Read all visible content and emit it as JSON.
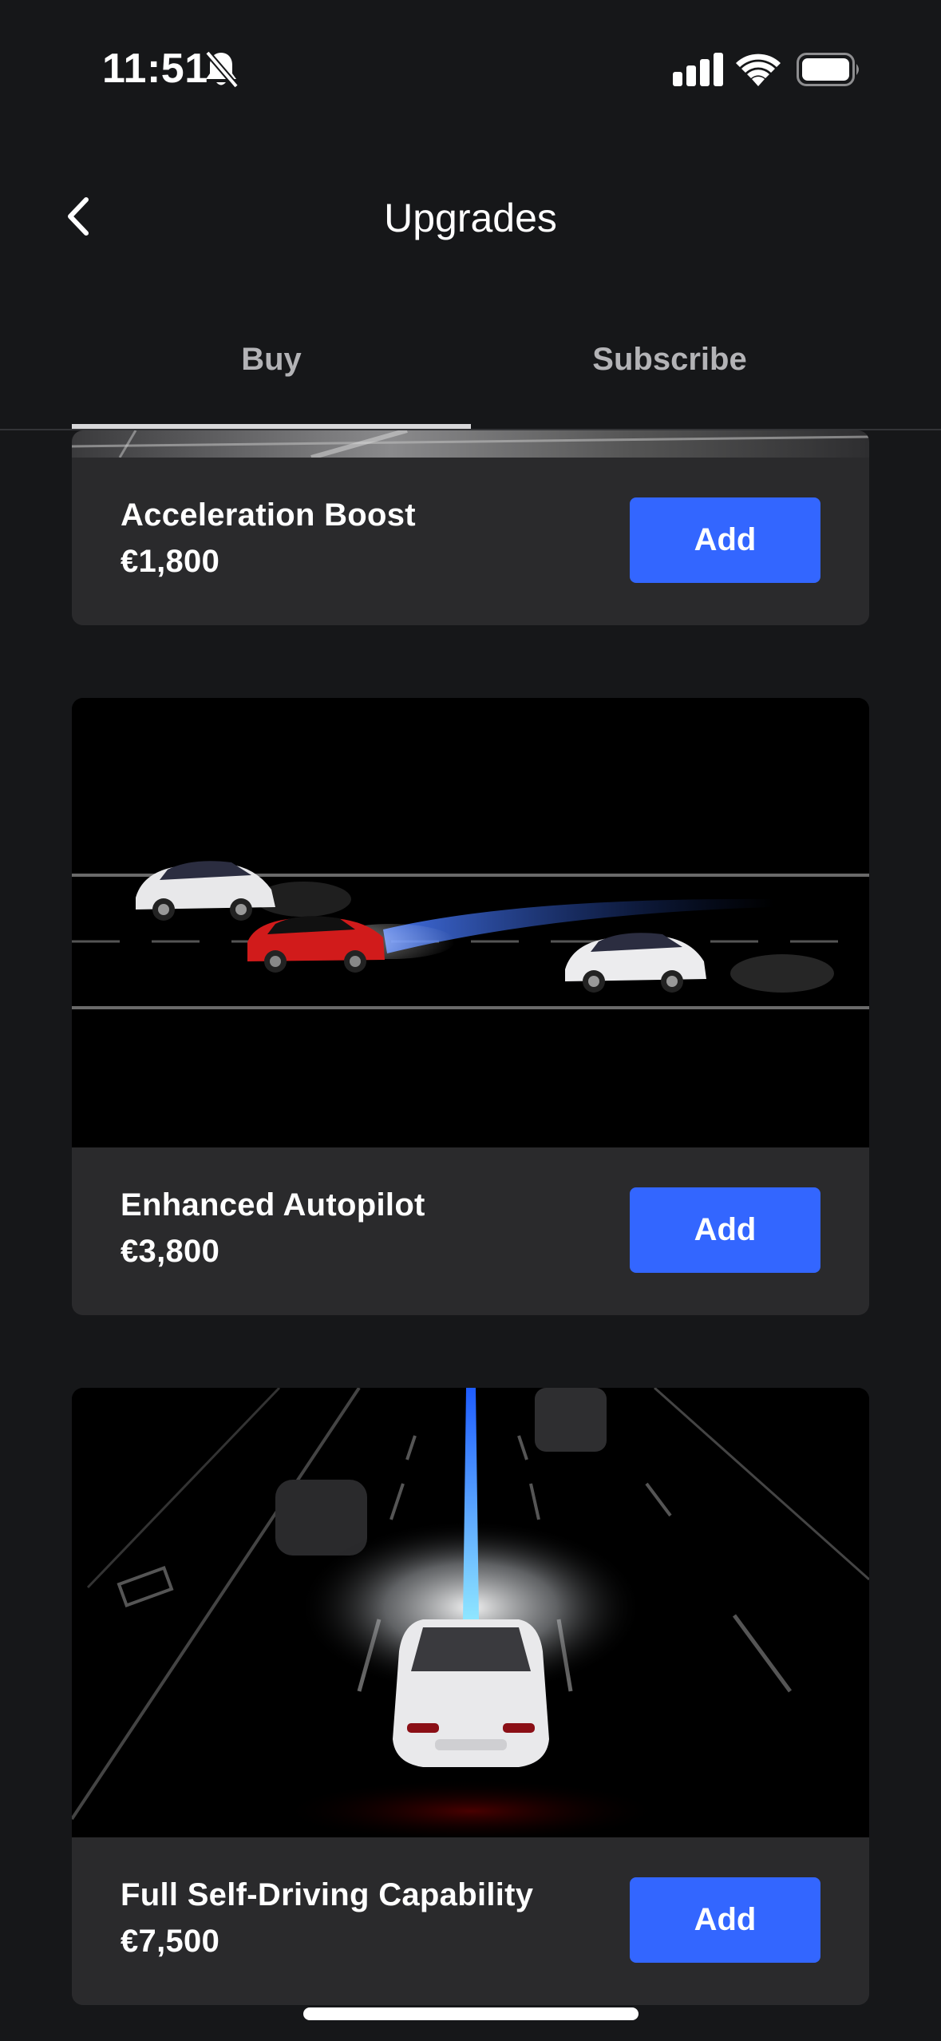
{
  "status_bar": {
    "time": "11:51",
    "icons": [
      "bell-slash-icon",
      "cellular-signal-icon",
      "wifi-icon",
      "battery-icon"
    ]
  },
  "header": {
    "title": "Upgrades",
    "back_icon": "chevron-left-icon"
  },
  "tabs": [
    {
      "label": "Buy",
      "active": true
    },
    {
      "label": "Subscribe",
      "active": false
    }
  ],
  "upgrades": [
    {
      "name": "Acceleration Boost",
      "price": "€1,800",
      "button_label": "Add"
    },
    {
      "name": "Enhanced Autopilot",
      "price": "€3,800",
      "button_label": "Add"
    },
    {
      "name": "Full Self-Driving Capability",
      "price": "€7,500",
      "button_label": "Add"
    }
  ],
  "colors": {
    "background": "#161719",
    "card": "#2a2a2c",
    "accent": "#3366ff",
    "tab_text": "#b3b3b6"
  }
}
